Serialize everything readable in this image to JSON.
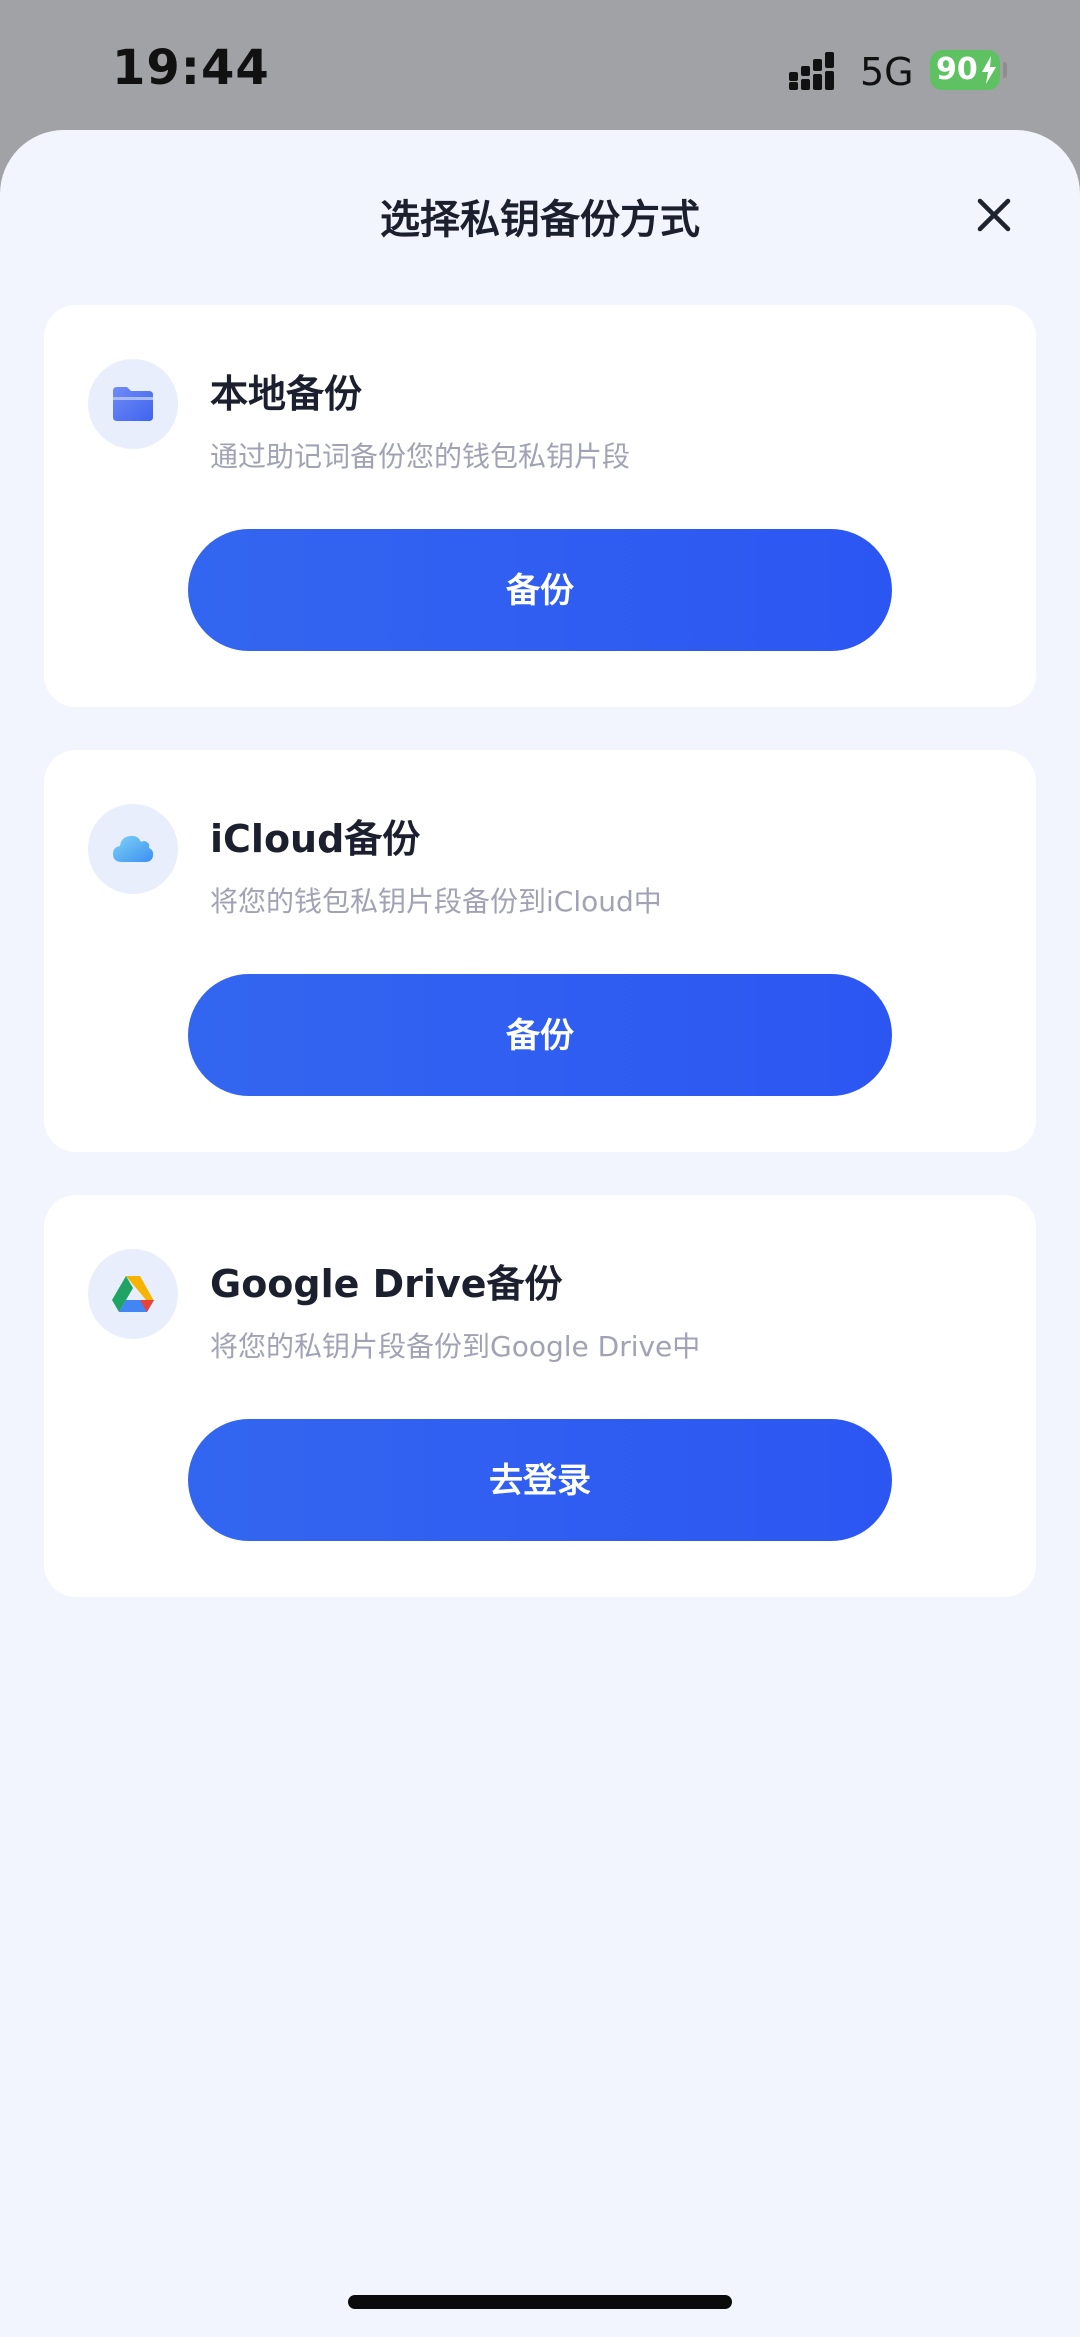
{
  "status_bar": {
    "time": "19:44",
    "network": "5G",
    "battery": "90"
  },
  "sheet": {
    "title": "选择私钥备份方式"
  },
  "cards": [
    {
      "icon": "folder-icon",
      "title": "本地备份",
      "description": "通过助记词备份您的钱包私钥片段",
      "button_label": "备份"
    },
    {
      "icon": "icloud-icon",
      "title": "iCloud备份",
      "description": "将您的钱包私钥片段备份到iCloud中",
      "button_label": "备份"
    },
    {
      "icon": "google-drive-icon",
      "title": "Google Drive备份",
      "description": "将您的私钥片段备份到Google Drive中",
      "button_label": "去登录"
    }
  ],
  "colors": {
    "accent": "#2f5ef2",
    "sheet_background": "#f2f5fe",
    "battery": "#5ec262"
  }
}
